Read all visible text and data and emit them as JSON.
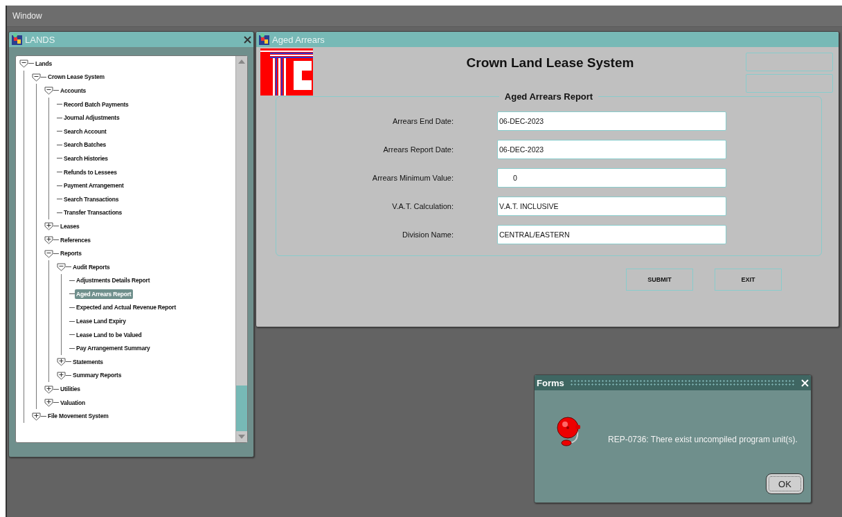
{
  "menu_bar": {
    "items": [
      "Window"
    ]
  },
  "lands_window": {
    "title": "LANDS",
    "tree": [
      {
        "label": "Lands",
        "expanded": true,
        "children": [
          {
            "label": "Crown Lease System",
            "expanded": true,
            "children": [
              {
                "label": "Accounts",
                "expanded": true,
                "children": [
                  {
                    "label": "Record Batch Payments",
                    "selected": false
                  },
                  {
                    "label": "Journal Adjustments",
                    "selected": false
                  },
                  {
                    "label": "Search Account",
                    "selected": false
                  },
                  {
                    "label": "Search Batches",
                    "selected": false
                  },
                  {
                    "label": "Search Histories",
                    "selected": false
                  },
                  {
                    "label": "Refunds to Lessees",
                    "selected": false
                  },
                  {
                    "label": "Payment Arrangement",
                    "selected": false
                  },
                  {
                    "label": "Search Transactions",
                    "selected": false
                  },
                  {
                    "label": "Transfer Transactions",
                    "selected": false
                  }
                ]
              },
              {
                "label": "Leases",
                "expanded": false
              },
              {
                "label": "References",
                "expanded": false
              },
              {
                "label": "Reports",
                "expanded": true,
                "children": [
                  {
                    "label": "Audit Reports",
                    "expanded": true,
                    "children": [
                      {
                        "label": "Adjustments Details Report",
                        "selected": false
                      },
                      {
                        "label": "Aged Arrears Report",
                        "selected": true
                      },
                      {
                        "label": "Expected and Actual Revenue Report",
                        "selected": false
                      },
                      {
                        "label": "Lease Land Expiry",
                        "selected": false
                      },
                      {
                        "label": "Lease Land to be Valued",
                        "selected": false
                      },
                      {
                        "label": "Pay Arrangement Summary",
                        "selected": false
                      }
                    ]
                  },
                  {
                    "label": "Statements",
                    "expanded": false
                  },
                  {
                    "label": "Summary Reports",
                    "expanded": false
                  }
                ]
              },
              {
                "label": "Utilities",
                "expanded": false
              },
              {
                "label": "Valuation",
                "expanded": false
              }
            ]
          },
          {
            "label": "File Movement System",
            "expanded": false
          }
        ]
      }
    ]
  },
  "form_window": {
    "title": "Aged Arrears",
    "heading": "Crown Land Lease System",
    "section_title": "Aged Arrears Report",
    "fields": [
      {
        "label": "Arrears End Date:",
        "value": "06-DEC-2023",
        "kind": "text"
      },
      {
        "label": "Arrears Report Date:",
        "value": "06-DEC-2023",
        "kind": "text"
      },
      {
        "label": "Arrears Minimum Value:",
        "value": "0",
        "kind": "number"
      },
      {
        "label": "V.A.T. Calculation:",
        "value": "V.A.T. INCLUSIVE",
        "kind": "text"
      },
      {
        "label": "Division Name:",
        "value": "CENTRAL/EASTERN",
        "kind": "text"
      }
    ],
    "buttons": [
      "SUBMIT",
      "EXIT"
    ]
  },
  "dialog": {
    "title": "Forms",
    "message": "REP-0736: There exist uncompiled program unit(s).",
    "button": "OK"
  }
}
